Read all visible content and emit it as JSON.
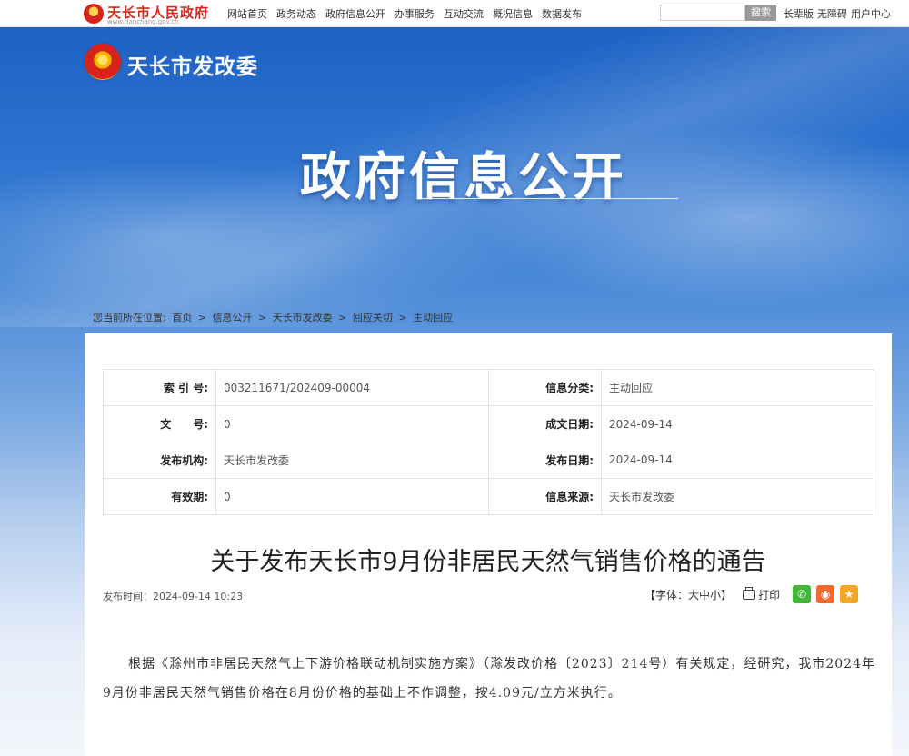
{
  "topbar": {
    "logo_name": "天长市人民政府",
    "logo_url": "www.tianchang.gov.cn",
    "nav": [
      "网站首页",
      "政务动态",
      "政府信息公开",
      "办事服务",
      "互动交流",
      "概况信息",
      "数据发布"
    ],
    "search_placeholder": "",
    "search_button": "搜索",
    "links": [
      "长辈版",
      "无障碍",
      "用户中心"
    ]
  },
  "header": {
    "site_title": "天长市发改委",
    "banner_title": "政府信息公开"
  },
  "breadcrumb": {
    "prefix": "您当前所在位置:",
    "items": [
      "首页",
      ">",
      "信息公开",
      ">",
      "天长市发改委",
      ">",
      "回应关切",
      ">",
      "主动回应"
    ]
  },
  "meta": {
    "index_label": "索 引 号:",
    "index_value": "003211671/202409-00004",
    "category_label": "信息分类:",
    "category_value": "主动回应",
    "docno_label": "文　　号:",
    "docno_value": "0",
    "created_label": "成文日期:",
    "created_value": "2024-09-14",
    "issuer_label": "发布机构:",
    "issuer_value": "天长市发改委",
    "published_label": "发布日期:",
    "published_value": "2024-09-14",
    "validity_label": "有效期:",
    "validity_value": "0",
    "source_label": "信息来源:",
    "source_value": "天长市发改委"
  },
  "article": {
    "title": "关于发布天长市9月份非居民天然气销售价格的通告",
    "pubtime": "发布时间：2024-09-14 10:23",
    "font_label_open": "【字体：",
    "font_large": "大",
    "font_medium": "中",
    "font_small": "小",
    "font_label_close": "】",
    "print_label": "打印",
    "body": "根据《滁州市非居民天然气上下游价格联动机制实施方案》（滁发改价格〔2023〕214号）有关规定，经研究，我市2024年9月份非居民天然气销售价格在8月份价格的基础上不作调整，按4.09元/立方米执行。"
  },
  "colors": {
    "accent": "#d22a1e",
    "banner_blue": "#1b5fc2"
  }
}
